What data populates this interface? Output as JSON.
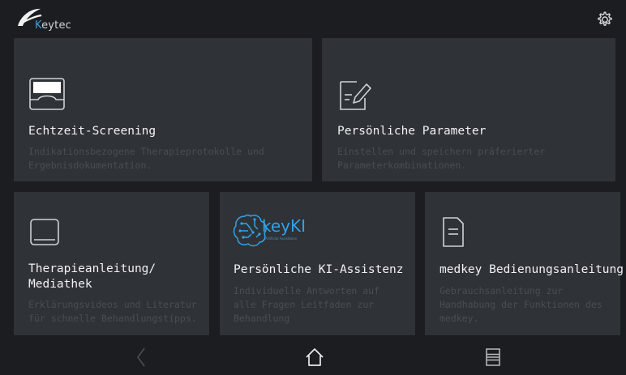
{
  "app": {
    "logo_k": "K",
    "logo_rest": "eytec"
  },
  "icons": {
    "settings": "gear-icon",
    "screening": "screen-device-icon",
    "parameters": "edit-document-icon",
    "mediathek": "book-icon",
    "ki": "keyki-brain-logo",
    "manual": "document-icon",
    "back": "chevron-left-icon",
    "home": "home-icon",
    "menu": "list-icon"
  },
  "tiles": [
    {
      "title": "Echtzeit-Screening",
      "desc_line1": "Indikationsbezogene Therapieprotokolle und",
      "desc_line2": "Ergebnisdokumentation."
    },
    {
      "title": "Persönliche Parameter",
      "desc_line1": "Einstellen und speichern präferierter",
      "desc_line2": "Parameterkombinationen."
    },
    {
      "title_line1": "Therapieanleitung/",
      "title_line2": "Mediathek",
      "desc_line1": "Erklärungsvideos und Literatur",
      "desc_line2": "für schnelle Behandlungstipps."
    },
    {
      "title": "Persönliche KI-Assistenz",
      "logo_text": "keyKI",
      "logo_sub": "Artificial Assistance",
      "desc_line1": "Individuelle Antworten auf",
      "desc_line2": "alle Fragen Leitfaden zur",
      "desc_line3": "Behandlung"
    },
    {
      "title": "medkey Bedienungsanleitung",
      "desc_line1": "Gebrauchsanleitung zur",
      "desc_line2": "Handhabung der Funktionen des",
      "desc_line3": "medkey."
    }
  ],
  "colors": {
    "background": "#1b1d20",
    "tile": "#2f3237",
    "accent": "#3aa0e6"
  }
}
